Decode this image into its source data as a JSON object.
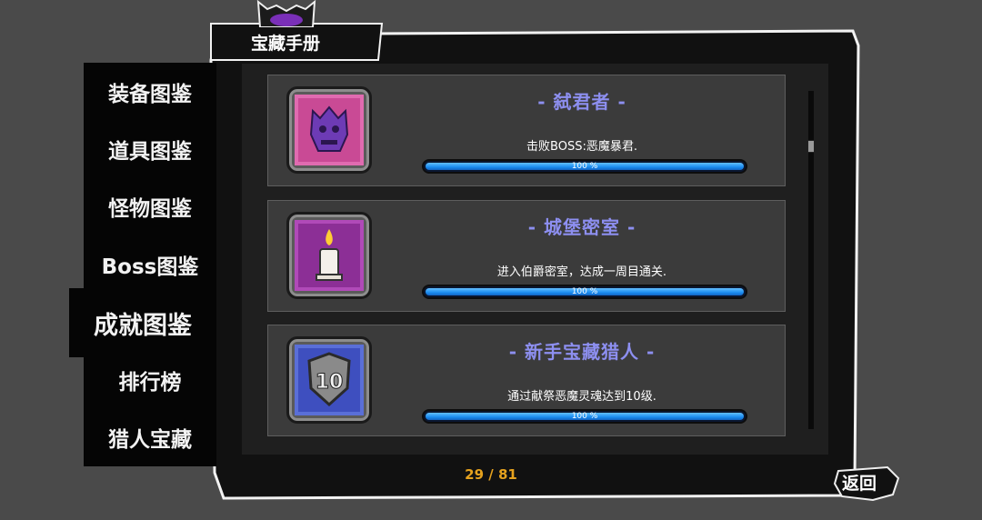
{
  "header": {
    "title": "宝藏手册"
  },
  "sidebar": {
    "items": [
      {
        "label": "装备图鉴",
        "active": false
      },
      {
        "label": "道具图鉴",
        "active": false
      },
      {
        "label": "怪物图鉴",
        "active": false
      },
      {
        "label": "Boss图鉴",
        "active": false
      },
      {
        "label": "成就图鉴",
        "active": true
      },
      {
        "label": "排行榜",
        "active": false
      },
      {
        "label": "猎人宝藏",
        "active": false
      }
    ]
  },
  "achievements": [
    {
      "title": "- 弑君者 -",
      "description": "击败BOSS:恶魔暴君.",
      "progress_label": "100 %",
      "progress": 1.0,
      "icon": "purple-demon-skull-icon",
      "icon_color": "#e06bb0"
    },
    {
      "title": "- 城堡密室 -",
      "description": "进入伯爵密室，达成一周目通关.",
      "progress_label": "100 %",
      "progress": 1.0,
      "icon": "candle-icon",
      "icon_color": "#b04ab8"
    },
    {
      "title": "- 新手宝藏猎人 -",
      "description": "通过献祭恶魔灵魂达到10级.",
      "progress_label": "100 %",
      "progress": 1.0,
      "icon": "level-10-shield-icon",
      "icon_color": "#5a6fd8"
    }
  ],
  "pagination": {
    "text": "29 / 81"
  },
  "footer": {
    "back_label": "返回"
  },
  "colors": {
    "accent_title": "#8d8ff0",
    "page_indicator": "#e6a21e",
    "progress_fill": "#1a8cf0"
  }
}
